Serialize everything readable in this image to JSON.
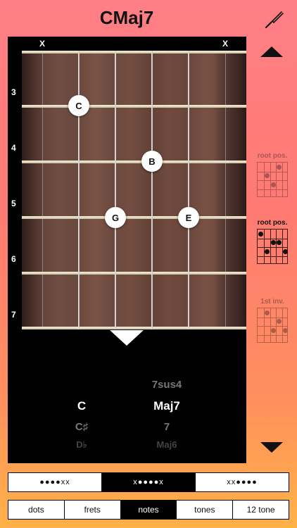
{
  "header": {
    "title": "CMaj7"
  },
  "fretboard": {
    "mute_markers": [
      "X",
      "X"
    ],
    "fret_numbers": [
      "3",
      "4",
      "5",
      "6",
      "7"
    ],
    "notes": [
      {
        "label": "C",
        "string": 2,
        "fret": 3
      },
      {
        "label": "B",
        "string": 4,
        "fret": 4
      },
      {
        "label": "G",
        "string": 3,
        "fret": 5
      },
      {
        "label": "E",
        "string": 5,
        "fret": 5
      }
    ]
  },
  "picker": {
    "root": {
      "above2": "",
      "above1": "",
      "selected": "C",
      "below1": "C♯",
      "below2": "D♭"
    },
    "quality": {
      "above2": "",
      "above1": "7sus4",
      "selected": "Maj7",
      "below1": "7",
      "below2": "Maj6"
    }
  },
  "voicings": [
    {
      "label": "",
      "style": "veryfaded",
      "dots": []
    },
    {
      "label": "root pos.",
      "style": "faded",
      "dots": [
        [
          1.5,
          1.5
        ],
        [
          3.5,
          0.5
        ],
        [
          2.5,
          2.5
        ]
      ]
    },
    {
      "label": "root pos.",
      "style": "",
      "dots": [
        [
          0.5,
          0.5
        ],
        [
          2.5,
          1.5
        ],
        [
          3.5,
          1.5
        ],
        [
          1.5,
          2.5
        ],
        [
          4.5,
          2.5
        ]
      ]
    },
    {
      "label": "1st inv.",
      "style": "faded",
      "dots": [
        [
          1.5,
          0.5
        ],
        [
          3.5,
          1.5
        ],
        [
          2.5,
          2.5
        ],
        [
          4.5,
          2.5
        ]
      ]
    },
    {
      "label": "",
      "style": "veryfaded",
      "dots": []
    }
  ],
  "string_patterns": {
    "options": [
      "●●●●xx",
      "x●●●●x",
      "xx●●●●"
    ],
    "selected_index": 1
  },
  "display_modes": {
    "options": [
      "dots",
      "frets",
      "notes",
      "tones",
      "12 tone"
    ],
    "selected_index": 2
  },
  "colors": {
    "accent": "#000000",
    "note_dot": "#ffffff"
  },
  "icons": {
    "tuner": "tuning-fork-icon",
    "prev": "triangle-up-icon",
    "next": "triangle-down-icon"
  }
}
